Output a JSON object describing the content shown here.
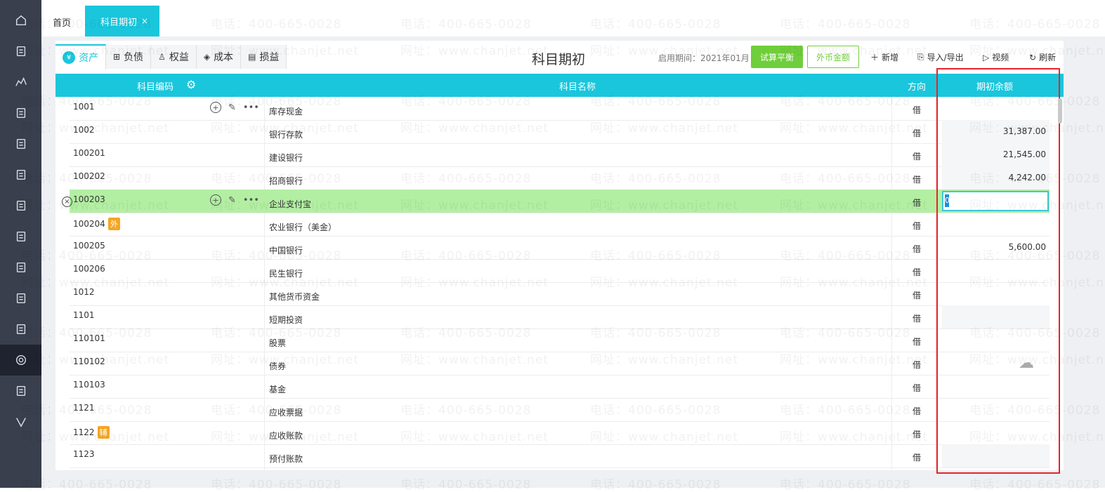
{
  "sidebar": {
    "icons": [
      "home-icon",
      "voucher-icon",
      "chart-icon",
      "money-bag-icon",
      "ledger-icon",
      "report-icon",
      "building-icon",
      "invoice-icon",
      "hand-coin-icon",
      "tax-icon",
      "inbox-icon",
      "settings-icon",
      "film-icon",
      "v-logo-icon"
    ]
  },
  "tabs": {
    "home": "首页",
    "active": "科目期初",
    "close": "×"
  },
  "categories": [
    {
      "label": "资产",
      "icon": "¥"
    },
    {
      "label": "负债",
      "icon": "⊞"
    },
    {
      "label": "权益",
      "icon": "♙"
    },
    {
      "label": "成本",
      "icon": "◈"
    },
    {
      "label": "损益",
      "icon": "▤"
    }
  ],
  "header": {
    "title": "科目期初",
    "period": "启用期间：2021年01月",
    "trial_balance": "试算平衡",
    "foreign_amount": "外币金额",
    "add": "新增",
    "import_export": "导入/导出",
    "video": "视频",
    "refresh": "刷新"
  },
  "table": {
    "columns": {
      "code": "科目编码",
      "name": "科目名称",
      "direction": "方向",
      "balance": "期初余额"
    },
    "rows": [
      {
        "code": "1001",
        "badge": "",
        "name": "库存现金",
        "dir": "借",
        "balance": ""
      },
      {
        "code": "1002",
        "badge": "",
        "name": "银行存款",
        "dir": "借",
        "balance": "31,387.00"
      },
      {
        "code": "100201",
        "badge": "",
        "name": "建设银行",
        "dir": "借",
        "balance": "21,545.00"
      },
      {
        "code": "100202",
        "badge": "",
        "name": "招商银行",
        "dir": "借",
        "balance": "4,242.00"
      },
      {
        "code": "100203",
        "badge": "",
        "name": "企业支付宝",
        "dir": "借",
        "balance": ""
      },
      {
        "code": "100204",
        "badge": "外",
        "name": "农业银行（美金）",
        "dir": "借",
        "balance": ""
      },
      {
        "code": "100205",
        "badge": "",
        "name": "中国银行",
        "dir": "借",
        "balance": "5,600.00"
      },
      {
        "code": "100206",
        "badge": "",
        "name": "民生银行",
        "dir": "借",
        "balance": ""
      },
      {
        "code": "1012",
        "badge": "",
        "name": "其他货币资金",
        "dir": "借",
        "balance": ""
      },
      {
        "code": "1101",
        "badge": "",
        "name": "短期投资",
        "dir": "借",
        "balance": ""
      },
      {
        "code": "110101",
        "badge": "",
        "name": "股票",
        "dir": "借",
        "balance": ""
      },
      {
        "code": "110102",
        "badge": "",
        "name": "债券",
        "dir": "借",
        "balance": ""
      },
      {
        "code": "110103",
        "badge": "",
        "name": "基金",
        "dir": "借",
        "balance": ""
      },
      {
        "code": "1121",
        "badge": "",
        "name": "应收票据",
        "dir": "借",
        "balance": ""
      },
      {
        "code": "1122",
        "badge": "辅",
        "name": "应收账款",
        "dir": "借",
        "balance": ""
      },
      {
        "code": "1123",
        "badge": "",
        "name": "预付账款",
        "dir": "借",
        "balance": ""
      }
    ],
    "editing_value": "0"
  },
  "watermark": {
    "phone": "电话：400-665-0028",
    "site": "网址：www.chanjet.net"
  },
  "colors": {
    "accent": "#1ac6dc",
    "green": "#6fce3b",
    "highlight": "#b3efa3",
    "annotation": "#e8232a"
  }
}
